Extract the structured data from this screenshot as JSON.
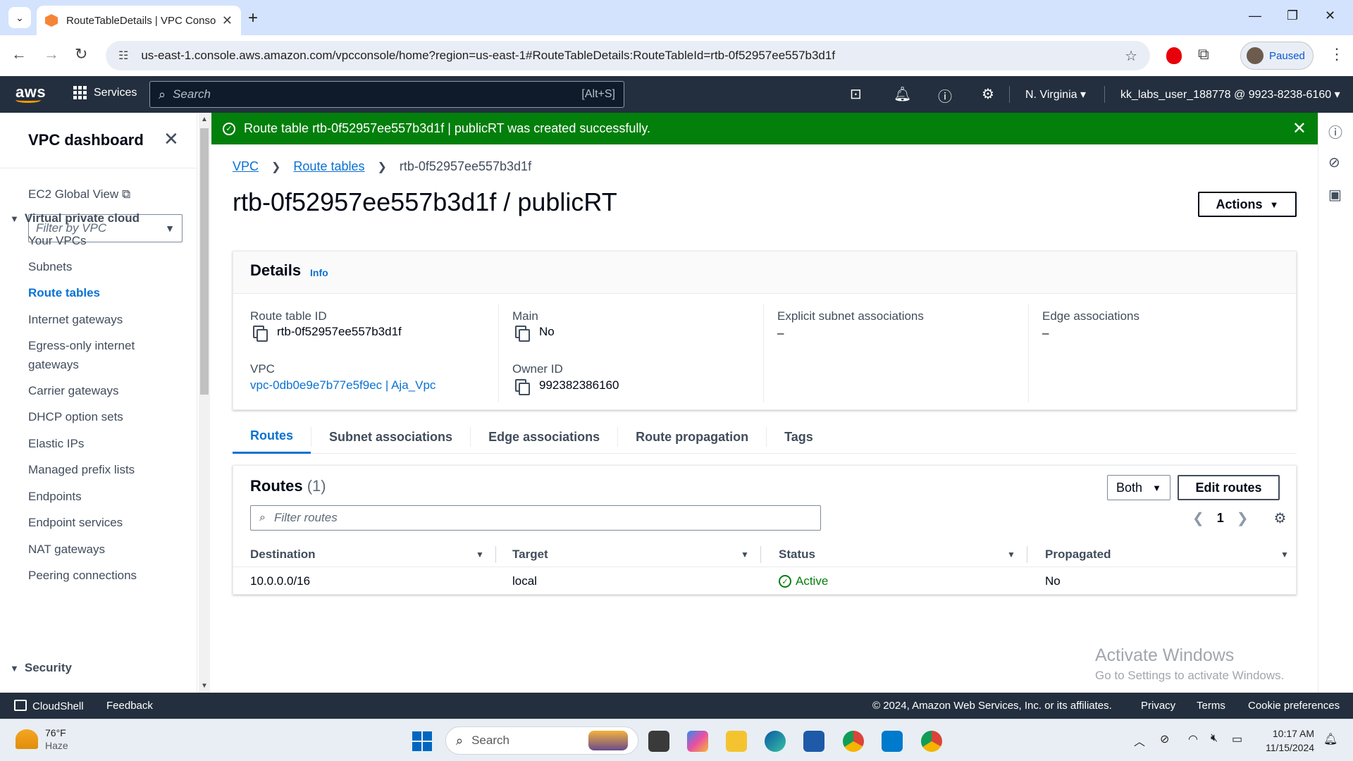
{
  "browser": {
    "tab_title": "RouteTableDetails | VPC Console",
    "url": "us-east-1.console.aws.amazon.com/vpcconsole/home?region=us-east-1#RouteTableDetails:RouteTableId=rtb-0f52957ee557b3d1f",
    "profile_status": "Paused"
  },
  "aws_nav": {
    "logo": "aws",
    "services_label": "Services",
    "search_placeholder": "Search",
    "search_shortcut": "[Alt+S]",
    "region": "N. Virginia",
    "account": "kk_labs_user_188778 @ 9923-8238-6160"
  },
  "sidebar": {
    "title": "VPC dashboard",
    "ec2_global_view": "EC2 Global View",
    "filter_placeholder": "Filter by VPC",
    "section_vpc": "Virtual private cloud",
    "items": [
      "Your VPCs",
      "Subnets",
      "Route tables",
      "Internet gateways",
      "Egress-only internet gateways",
      "Carrier gateways",
      "DHCP option sets",
      "Elastic IPs",
      "Managed prefix lists",
      "Endpoints",
      "Endpoint services",
      "NAT gateways",
      "Peering connections"
    ],
    "active_item": "Route tables",
    "section_security": "Security"
  },
  "flash": {
    "message": "Route table rtb-0f52957ee557b3d1f | publicRT was created successfully."
  },
  "breadcrumb": {
    "vpc": "VPC",
    "route_tables": "Route tables",
    "current": "rtb-0f52957ee557b3d1f"
  },
  "page": {
    "title": "rtb-0f52957ee557b3d1f / publicRT",
    "actions_label": "Actions"
  },
  "details": {
    "title": "Details",
    "info": "Info",
    "route_table_id_label": "Route table ID",
    "route_table_id": "rtb-0f52957ee557b3d1f",
    "vpc_label": "VPC",
    "vpc_value": "vpc-0db0e9e7b77e5f9ec | Aja_Vpc",
    "main_label": "Main",
    "main_value": "No",
    "owner_label": "Owner ID",
    "owner_value": "992382386160",
    "explicit_label": "Explicit subnet associations",
    "explicit_value": "–",
    "edge_label": "Edge associations",
    "edge_value": "–"
  },
  "tabs": [
    "Routes",
    "Subnet associations",
    "Edge associations",
    "Route propagation",
    "Tags"
  ],
  "routes": {
    "title": "Routes",
    "count": "(1)",
    "both_label": "Both",
    "edit_label": "Edit routes",
    "filter_placeholder": "Filter routes",
    "page": "1",
    "columns": [
      "Destination",
      "Target",
      "Status",
      "Propagated"
    ],
    "rows": [
      {
        "destination": "10.0.0.0/16",
        "target": "local",
        "status": "Active",
        "propagated": "No"
      }
    ]
  },
  "watermark": {
    "line1": "Activate Windows",
    "line2": "Go to Settings to activate Windows."
  },
  "footer": {
    "cloudshell": "CloudShell",
    "feedback": "Feedback",
    "copyright": "© 2024, Amazon Web Services, Inc. or its affiliates.",
    "privacy": "Privacy",
    "terms": "Terms",
    "cookies": "Cookie preferences"
  },
  "taskbar": {
    "temp": "76°F",
    "weather": "Haze",
    "search_placeholder": "Search",
    "time": "10:17 AM",
    "date": "11/15/2024"
  },
  "colors": {
    "aws_nav": "#232f3e",
    "success": "#037f0c",
    "link": "#0972d3"
  }
}
